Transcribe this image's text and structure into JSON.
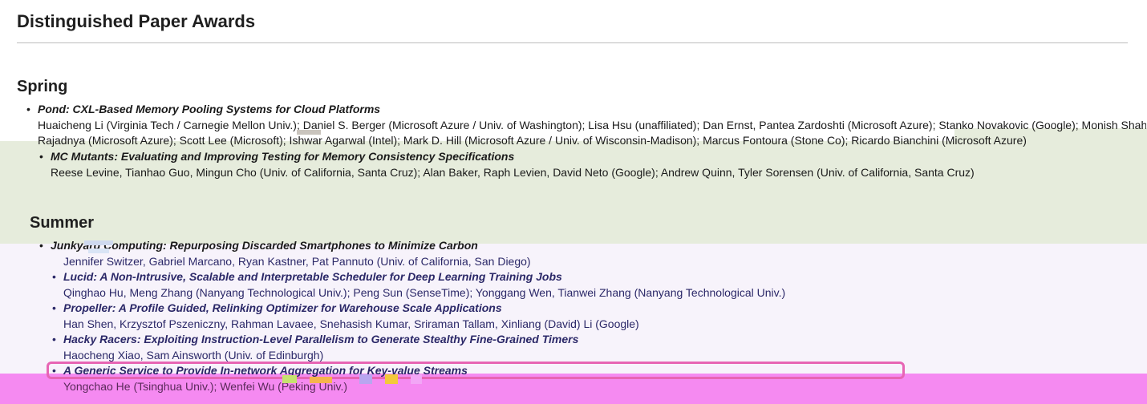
{
  "page": {
    "title": "Distinguished Paper Awards"
  },
  "sections": [
    {
      "name": "Spring",
      "papers": [
        {
          "title": "Pond: CXL-Based Memory Pooling Systems for Cloud Platforms",
          "authors_line1": "Huaicheng Li (Virginia Tech / Carnegie Mellon Univ.); Daniel S. Berger (Microsoft Azure / Univ. of Washington); Lisa Hsu (unaffiliated); Dan Ernst, Pantea Zardoshti (Microsoft Azure); Stanko Novakovic (Google); Monish Shah, Samir",
          "authors_line2": "Rajadnya (Microsoft Azure); Scott Lee (Microsoft); Ishwar Agarwal (Intel); Mark D. Hill (Microsoft Azure / Univ. of Wisconsin-Madison); Marcus Fontoura (Stone Co); Ricardo Bianchini (Microsoft Azure)"
        },
        {
          "title": "MC Mutants: Evaluating and Improving Testing for Memory Consistency Specifications",
          "authors": "Reese Levine, Tianhao Guo, Mingun Cho (Univ. of California, Santa Cruz); Alan Baker, Raph Levien, David Neto (Google); Andrew Quinn, Tyler Sorensen (Univ. of California, Santa Cruz)"
        }
      ]
    },
    {
      "name": "Summer",
      "papers": [
        {
          "title": "Junkyard Computing: Repurposing Discarded Smartphones to Minimize Carbon",
          "authors": "Jennifer Switzer, Gabriel Marcano, Ryan Kastner, Pat Pannuto (Univ. of California, San Diego)"
        },
        {
          "title": "Lucid: A Non-Intrusive, Scalable and Interpretable Scheduler for Deep Learning Training Jobs",
          "authors": "Qinghao Hu, Meng Zhang (Nanyang Technological Univ.); Peng Sun (SenseTime); Yonggang Wen, Tianwei Zhang (Nanyang Technological Univ.)"
        },
        {
          "title": "Propeller: A Profile Guided, Relinking Optimizer for Warehouse Scale Applications",
          "authors": "Han Shen, Krzysztof Pszeniczny, Rahman Lavaee, Snehasish Kumar, Sriraman Tallam, Xinliang (David) Li (Google)"
        },
        {
          "title": "Hacky Racers: Exploiting Instruction-Level Parallelism to Generate Stealthy Fine-Grained Timers",
          "authors": "Haocheng Xiao, Sam Ainsworth (Univ. of Edinburgh)"
        },
        {
          "title": "A Generic Service to Provide In-network Aggregation for Key-value Streams",
          "authors": "Yongchao He (Tsinghua Univ.); Wenfei Wu (Peking Univ.)"
        }
      ]
    }
  ],
  "bullet": "•",
  "colors": {
    "band_green": "#e6ecdc",
    "band_purple": "#f7f3fb",
    "band_pink": "#f58af1",
    "outline_pink": "#e765b4",
    "text_purple": "#2b2868"
  }
}
